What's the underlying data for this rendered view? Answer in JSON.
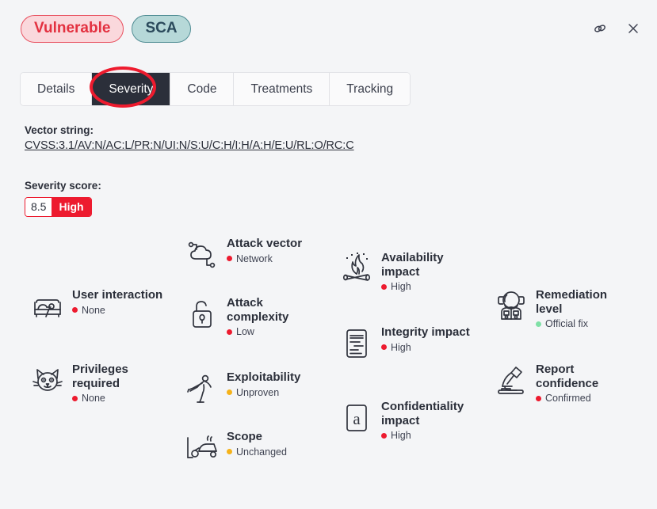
{
  "window": {
    "link_icon": "link-icon",
    "close_icon": "close-icon"
  },
  "badges": [
    {
      "label": "Vulnerable",
      "type": "vulnerable"
    },
    {
      "label": "SCA",
      "type": "sca"
    }
  ],
  "tabs": [
    {
      "label": "Details",
      "active": false
    },
    {
      "label": "Severity",
      "active": true
    },
    {
      "label": "Code",
      "active": false
    },
    {
      "label": "Treatments",
      "active": false
    },
    {
      "label": "Tracking",
      "active": false
    }
  ],
  "vector": {
    "label": "Vector string",
    "colon": ":",
    "value": "CVSS:3.1/AV:N/AC:L/PR:N/UI:N/S:U/C:H/I:H/A:H/E:U/RL:O/RC:C"
  },
  "score": {
    "label": "Severity score",
    "colon": ":",
    "number": "8.5",
    "severity": "High",
    "color": "#ed1b2f"
  },
  "colors": {
    "red": "#ed1b2f",
    "amber": "#f5b21a",
    "green": "#7fe0a6"
  },
  "metrics": [
    {
      "id": "user-interaction",
      "title": "User interaction",
      "value": "None",
      "dot": "#ed1b2f",
      "icon": "bed-person-icon"
    },
    {
      "id": "privileges-required",
      "title": "Privileges required",
      "value": "None",
      "dot": "#ed1b2f",
      "icon": "cat-face-icon"
    },
    {
      "id": "attack-vector",
      "title": "Attack vector",
      "value": "Network",
      "dot": "#ed1b2f",
      "icon": "cloud-network-icon"
    },
    {
      "id": "attack-complexity",
      "title": "Attack complexity",
      "value": "Low",
      "dot": "#ed1b2f",
      "icon": "open-padlock-icon"
    },
    {
      "id": "exploitability",
      "title": "Exploitability",
      "value": "Unproven",
      "dot": "#f5b21a",
      "icon": "karate-kick-icon"
    },
    {
      "id": "scope",
      "title": "Scope",
      "value": "Unchanged",
      "dot": "#f5b21a",
      "icon": "lawnmower-icon"
    },
    {
      "id": "availability-impact",
      "title": "Availability impact",
      "value": "High",
      "dot": "#ed1b2f",
      "icon": "campfire-icon"
    },
    {
      "id": "integrity-impact",
      "title": "Integrity impact",
      "value": "High",
      "dot": "#ed1b2f",
      "icon": "document-lines-icon"
    },
    {
      "id": "confidentiality-impact",
      "title": "Confidentiality impact",
      "value": "High",
      "dot": "#ed1b2f",
      "icon": "letter-a-icon"
    },
    {
      "id": "remediation-level",
      "title": "Remediation level",
      "value": "Official fix",
      "dot": "#7fe0a6",
      "icon": "astronaut-icon"
    },
    {
      "id": "report-confidence",
      "title": "Report confidence",
      "value": "Confirmed",
      "dot": "#ed1b2f",
      "icon": "microscope-icon"
    }
  ]
}
